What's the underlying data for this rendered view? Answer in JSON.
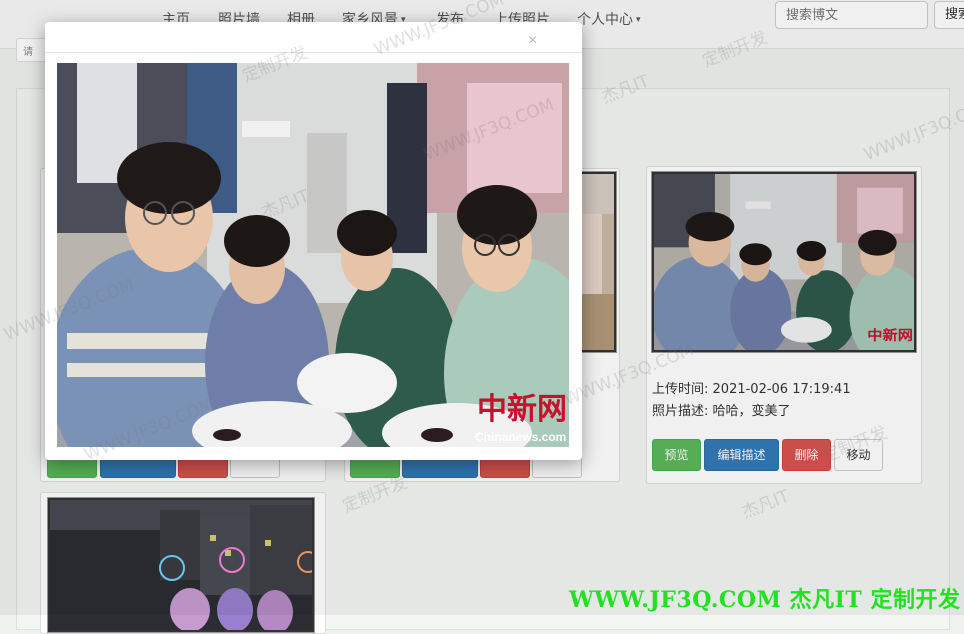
{
  "nav": {
    "items": [
      "主页",
      "照片墙",
      "相册",
      "家乡风景",
      "发布",
      "上传照片",
      "个人中心"
    ],
    "dropdown_caret": "▾",
    "search_placeholder": "搜索博文",
    "search_button": "搜索"
  },
  "breadcrumb_stub": "请",
  "cards": [
    {
      "upload_label": "上传时间:",
      "upload_time": "2021-02-06 17:19:41",
      "desc_label": "照片描述:",
      "description": "哈哈，变美了",
      "buttons": {
        "preview": "预览",
        "edit": "编辑描述",
        "delete": "删除",
        "move": "移动"
      }
    }
  ],
  "modal": {
    "close_glyph": "×",
    "photo_logo_text": "中新网",
    "photo_logo_url": "Chinanews.com"
  },
  "watermark": {
    "site": "WWW.JF3Q.COM",
    "brand": "杰凡IT",
    "slogan": "定制开发"
  },
  "colors": {
    "preview": "#5cb85c",
    "edit": "#337ab7",
    "delete": "#d9534f",
    "banner": "#22e022"
  }
}
